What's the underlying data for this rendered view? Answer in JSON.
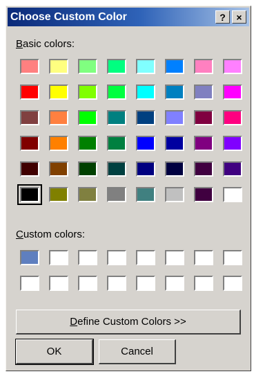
{
  "dialog": {
    "title": "Choose Custom Color",
    "help_label": "?",
    "close_label": "×"
  },
  "basic": {
    "label_first": "B",
    "label_rest": "asic colors:",
    "rows": [
      [
        "#ff8080",
        "#ffff80",
        "#80ff80",
        "#00ff80",
        "#80ffff",
        "#0080ff",
        "#ff80c0",
        "#ff80ff"
      ],
      [
        "#ff0000",
        "#ffff00",
        "#80ff00",
        "#00ff40",
        "#00ffff",
        "#0080c0",
        "#8080c0",
        "#ff00ff"
      ],
      [
        "#804040",
        "#ff8040",
        "#00ff00",
        "#008080",
        "#004080",
        "#8080ff",
        "#800040",
        "#ff0080"
      ],
      [
        "#800000",
        "#ff8000",
        "#008000",
        "#008040",
        "#0000ff",
        "#0000a0",
        "#800080",
        "#8000ff"
      ],
      [
        "#400000",
        "#804000",
        "#004000",
        "#004040",
        "#000080",
        "#000040",
        "#400040",
        "#400080"
      ],
      [
        "#000000",
        "#808000",
        "#808040",
        "#808080",
        "#408080",
        "#c0c0c0",
        "#400040",
        "#ffffff"
      ]
    ],
    "selected": [
      5,
      0
    ]
  },
  "custom": {
    "label_first": "C",
    "label_rest": "ustom colors:",
    "rows": [
      [
        "#5f7fbf",
        "#ffffff",
        "#ffffff",
        "#ffffff",
        "#ffffff",
        "#ffffff",
        "#ffffff",
        "#ffffff"
      ],
      [
        "#ffffff",
        "#ffffff",
        "#ffffff",
        "#ffffff",
        "#ffffff",
        "#ffffff",
        "#ffffff",
        "#ffffff"
      ]
    ]
  },
  "buttons": {
    "define_first": "D",
    "define_rest": "efine Custom Colors >>",
    "ok": "OK",
    "cancel": "Cancel"
  }
}
